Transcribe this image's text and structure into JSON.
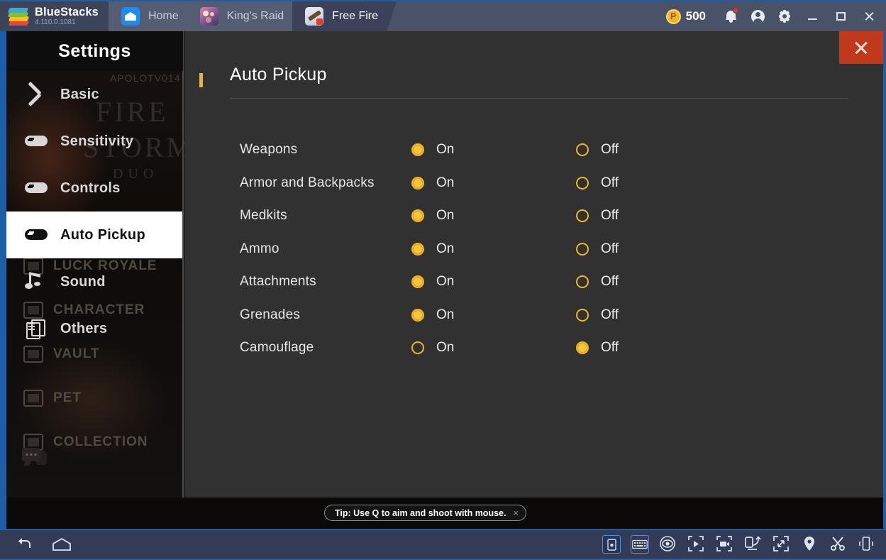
{
  "app": {
    "brand_name": "BlueStacks",
    "version": "4.110.0.1081"
  },
  "topbar": {
    "tabs": [
      {
        "label": "Home",
        "icon": "home-icon",
        "active": false
      },
      {
        "label": "King's Raid",
        "icon": "kings-raid-icon",
        "active": false
      },
      {
        "label": "Free Fire",
        "icon": "free-fire-icon",
        "active": true
      }
    ],
    "points": {
      "value": "500",
      "currency_symbol": "P",
      "icon": "coin-icon"
    },
    "icons": [
      {
        "name": "notification-bell-icon",
        "badge": true
      },
      {
        "name": "user-avatar-icon"
      },
      {
        "name": "settings-gear-icon"
      }
    ],
    "window_controls": [
      {
        "name": "minimize-button",
        "glyph": "minimize-icon"
      },
      {
        "name": "maximize-button",
        "glyph": "maximize-icon"
      },
      {
        "name": "close-button",
        "glyph": "close-icon"
      }
    ]
  },
  "sidebar": {
    "title": "Settings",
    "items": [
      {
        "label": "Basic",
        "icon": "tools-icon",
        "active": false
      },
      {
        "label": "Sensitivity",
        "icon": "gamepad-icon",
        "active": false
      },
      {
        "label": "Controls",
        "icon": "gamepad-icon",
        "active": false
      },
      {
        "label": "Auto Pickup",
        "icon": "gamepad-icon",
        "active": true
      },
      {
        "label": "Sound",
        "icon": "music-note-icon",
        "active": false
      },
      {
        "label": "Others",
        "icon": "copy-icon",
        "active": false
      }
    ]
  },
  "game_background": {
    "player_tag": "APOLOTV014",
    "title_lines": [
      "FIRE",
      "STORM",
      "DUO"
    ],
    "menu_items": [
      "LUCK ROYALE",
      "CHARACTER",
      "VAULT",
      "PET",
      "COLLECTION"
    ],
    "chat_icon": "chat-bubble-icon"
  },
  "panel": {
    "title": "Auto Pickup",
    "close_icon": "close-icon",
    "accent_color": "#f0b428",
    "option_on_label": "On",
    "option_off_label": "Off",
    "rows": [
      {
        "label": "Weapons",
        "selected": "On"
      },
      {
        "label": "Armor and Backpacks",
        "selected": "On"
      },
      {
        "label": "Medkits",
        "selected": "On"
      },
      {
        "label": "Ammo",
        "selected": "On"
      },
      {
        "label": "Attachments",
        "selected": "On"
      },
      {
        "label": "Grenades",
        "selected": "On"
      },
      {
        "label": "Camouflage",
        "selected": "Off"
      }
    ]
  },
  "tip": {
    "text": "Tip: Use Q to aim and shoot with mouse.",
    "close_glyph": "×"
  },
  "bottombar": {
    "left_icons": [
      {
        "name": "back-button",
        "icon": "back-arrow-icon"
      },
      {
        "name": "home-button",
        "icon": "home-outline-icon"
      }
    ],
    "right_icons": [
      {
        "name": "game-controls-button",
        "icon": "game-controls-icon",
        "active": true
      },
      {
        "name": "keyboard-controls-button",
        "icon": "keyboard-icon",
        "active": false
      },
      {
        "name": "eye-button",
        "icon": "eye-icon",
        "active": false
      },
      {
        "name": "screenshot-button",
        "icon": "screenshot-icon",
        "active": false
      },
      {
        "name": "record-button",
        "icon": "video-camera-icon",
        "active": false
      },
      {
        "name": "rotate-button",
        "icon": "rotate-screen-icon",
        "active": false
      },
      {
        "name": "fullscreen-button",
        "icon": "fullscreen-icon",
        "active": false
      },
      {
        "name": "location-button",
        "icon": "location-pin-icon",
        "active": false
      },
      {
        "name": "cut-button",
        "icon": "scissors-icon",
        "active": false
      },
      {
        "name": "shake-button",
        "icon": "shake-phone-icon",
        "active": false
      }
    ]
  }
}
